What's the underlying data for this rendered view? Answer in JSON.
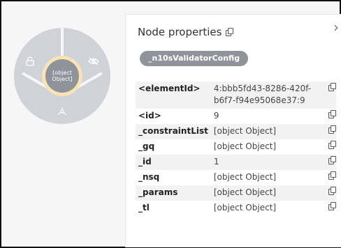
{
  "node": {
    "caption": "[object Object]"
  },
  "panel": {
    "title": "Node properties",
    "label": "_n10sValidatorConfig",
    "properties": [
      {
        "key": "<elementId>",
        "value": "4:bbb5fd43-8286-420f-b6f7-f94e95068e37:9"
      },
      {
        "key": "<id>",
        "value": "9"
      },
      {
        "key": "_constraintList",
        "value": "[object Object]"
      },
      {
        "key": "_gq",
        "value": "[object Object]"
      },
      {
        "key": "_id",
        "value": "1"
      },
      {
        "key": "_nsq",
        "value": "[object Object]"
      },
      {
        "key": "_params",
        "value": "[object Object]"
      },
      {
        "key": "_tl",
        "value": "[object Object]"
      }
    ]
  },
  "icons": {
    "lock": "lock-icon",
    "hide": "eye-off-icon",
    "expand": "expand-icon",
    "copy": "copy-icon",
    "close": "chevron-right-icon"
  }
}
